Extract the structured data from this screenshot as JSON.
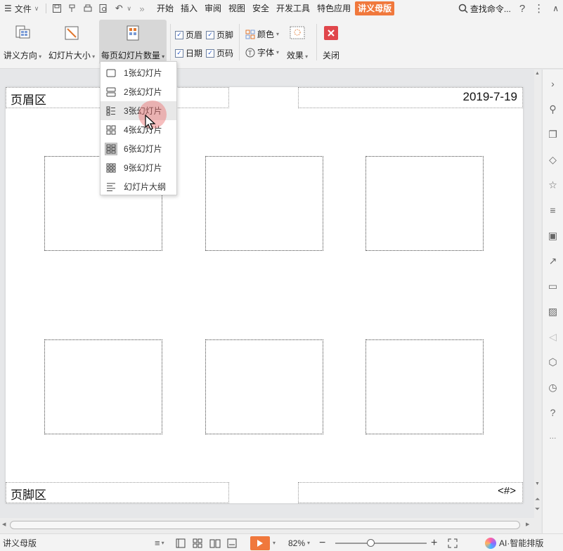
{
  "topbar": {
    "file_menu": "文件",
    "tabs": [
      "开始",
      "插入",
      "审阅",
      "视图",
      "安全",
      "开发工具",
      "特色应用",
      "讲义母版"
    ],
    "active_tab": "讲义母版",
    "search_label": "查找命令...",
    "help": "?",
    "more": "⋮",
    "collapse": "∧"
  },
  "ribbon": {
    "orientation_label": "讲义方向",
    "slide_size_label": "幻灯片大小",
    "per_page_label": "每页幻灯片数量",
    "header_label": "页眉",
    "footer_label": "页脚",
    "date_label": "日期",
    "page_num_label": "页码",
    "color_label": "颜色",
    "font_label": "字体",
    "effect_label": "效果",
    "close_label": "关闭"
  },
  "dropdown": {
    "items": [
      "1张幻灯片",
      "2张幻灯片",
      "3张幻灯片",
      "4张幻灯片",
      "6张幻灯片",
      "9张幻灯片",
      "幻灯片大纲"
    ],
    "hovered": "3张幻灯片",
    "selected": "6张幻灯片"
  },
  "page": {
    "header_text": "页眉区",
    "date_text": "2019-7-19",
    "footer_text": "页脚区",
    "page_num_text": "<#>"
  },
  "statusbar": {
    "mode_label": "讲义母版",
    "zoom": "82%",
    "ai_label": "AI·智能排版"
  },
  "colors": {
    "accent": "#f0783c",
    "ribbon_bg": "#f3f3f3",
    "canvas_bg": "#e6e7e9"
  }
}
